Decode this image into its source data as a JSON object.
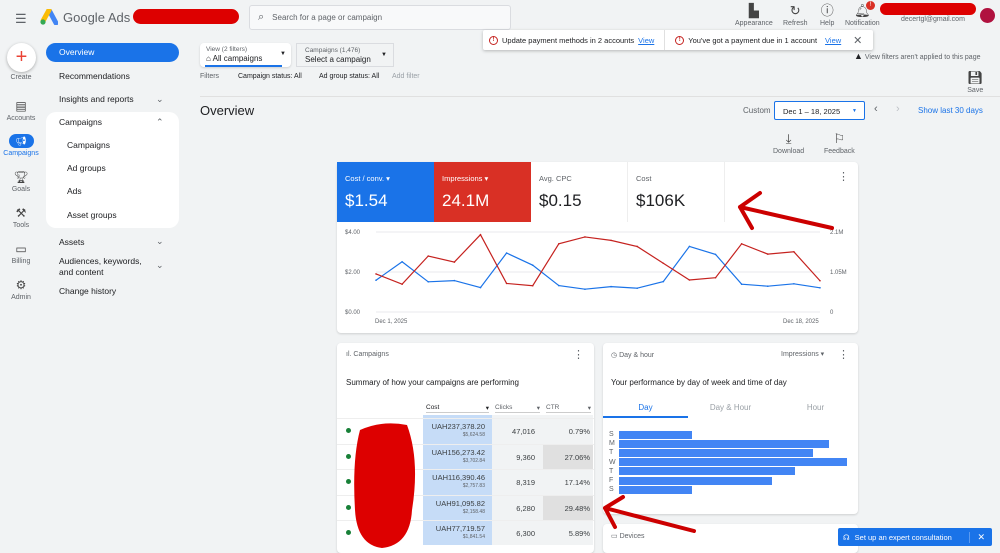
{
  "header": {
    "product": "Google Ads",
    "search_placeholder": "Search for a page or campaign",
    "buttons": [
      {
        "label": "Appearance",
        "icon": "appearance-icon"
      },
      {
        "label": "Refresh",
        "icon": "refresh-icon"
      },
      {
        "label": "Help",
        "icon": "help-icon"
      },
      {
        "label": "Notification",
        "icon": "bell-icon",
        "badge": "!"
      }
    ],
    "email": "decertgl@gmail.com"
  },
  "rail": [
    {
      "label": "Create"
    },
    {
      "label": "Accounts"
    },
    {
      "label": "Campaigns",
      "active": true
    },
    {
      "label": "Goals"
    },
    {
      "label": "Tools"
    },
    {
      "label": "Billing"
    },
    {
      "label": "Admin"
    }
  ],
  "nav": {
    "overview": "Overview",
    "recommendations": "Recommendations",
    "insights": "Insights and reports",
    "campaigns": "Campaigns",
    "sub": [
      "Campaigns",
      "Ad groups",
      "Ads",
      "Asset groups"
    ],
    "assets": "Assets",
    "audiences": "Audiences, keywords, and content",
    "history": "Change history"
  },
  "banners": [
    {
      "text": "Update payment methods in 2 accounts",
      "link": "View"
    },
    {
      "text": "You've got a payment due in 1 account",
      "link": "View"
    }
  ],
  "view_selector": {
    "label": "View (2 filters)",
    "value": "All campaigns"
  },
  "campaign_selector": {
    "label": "Campaigns (1,476)",
    "value": "Select a campaign"
  },
  "filters": {
    "label": "Filters",
    "chips": [
      "Campaign status: All",
      "Ad group status: All"
    ],
    "add": "Add filter"
  },
  "warning": "View filters aren't applied to this page",
  "save": "Save",
  "page_title": "Overview",
  "date": {
    "label": "Custom",
    "value": "Dec 1 – 18, 2025",
    "show_last": "Show last 30 days"
  },
  "actions": {
    "download": "Download",
    "feedback": "Feedback"
  },
  "metrics": [
    {
      "label": "Cost / conv.",
      "value": "$1.54",
      "color": "#1a73e8"
    },
    {
      "label": "Impressions",
      "value": "24.1M",
      "color": "#d93025"
    },
    {
      "label": "Avg. CPC",
      "value": "$0.15"
    },
    {
      "label": "Cost",
      "value": "$106K"
    }
  ],
  "chart_data": {
    "type": "line",
    "x_start": "Dec 1, 2025",
    "x_end": "Dec 18, 2025",
    "left_ticks": [
      "$4.00",
      "$2.00",
      "$0.00"
    ],
    "right_ticks": [
      "2.1M",
      "1.05M",
      "0"
    ],
    "ylim_left": [
      0,
      4
    ],
    "ylim_right": [
      0,
      2100000
    ],
    "grid": true,
    "series": [
      {
        "name": "Cost / conv.",
        "axis": "left",
        "color": "#1a73e8",
        "values": [
          1.59,
          2.51,
          1.51,
          1.57,
          1.22,
          2.95,
          2.34,
          1.32,
          1.14,
          1.27,
          1.19,
          1.52,
          3.28,
          2.88,
          1.39,
          1.29,
          1.41,
          1.21
        ]
      },
      {
        "name": "Impressions",
        "axis": "right",
        "color": "#c5221f",
        "values": [
          1000000,
          730000,
          1470000,
          1310000,
          2030000,
          750000,
          690000,
          1790000,
          1970000,
          1880000,
          1720000,
          1280000,
          840000,
          900000,
          1790000,
          1520000,
          1580000,
          820000
        ]
      }
    ]
  },
  "campaigns_card": {
    "title": "Campaigns",
    "subtitle": "Summary of how your campaigns are performing",
    "columns": [
      "Cost",
      "Clicks",
      "CTR"
    ],
    "rows": [
      {
        "cost": "UAH237,378.20",
        "cost_usd": "$5,624.58",
        "clicks": "47,016",
        "ctr": "0.79%"
      },
      {
        "cost": "UAH156,273.42",
        "cost_usd": "$3,702.84",
        "clicks": "9,360",
        "ctr": "27.06%"
      },
      {
        "cost": "UAH116,390.46",
        "cost_usd": "$2,757.83",
        "clicks": "8,319",
        "ctr": "17.14%"
      },
      {
        "cost": "UAH91,095.82",
        "cost_usd": "$2,158.48",
        "clicks": "6,280",
        "ctr": "29.48%"
      },
      {
        "cost": "UAH77,719.57",
        "cost_usd": "$1,841.54",
        "clicks": "6,300",
        "ctr": "5.89%"
      }
    ]
  },
  "dayhour_card": {
    "title": "Day & hour",
    "metric": "Impressions",
    "subtitle": "Your performance by day of week and time of day",
    "tabs": [
      "Day",
      "Day & Hour",
      "Hour"
    ],
    "days": [
      "S",
      "M",
      "T",
      "W",
      "T",
      "F",
      "S"
    ],
    "values": [
      0.32,
      0.92,
      0.85,
      1.0,
      0.77,
      0.67,
      0.32
    ]
  },
  "devices_card": {
    "title": "Devices"
  },
  "consult": "Set up an expert consultation"
}
